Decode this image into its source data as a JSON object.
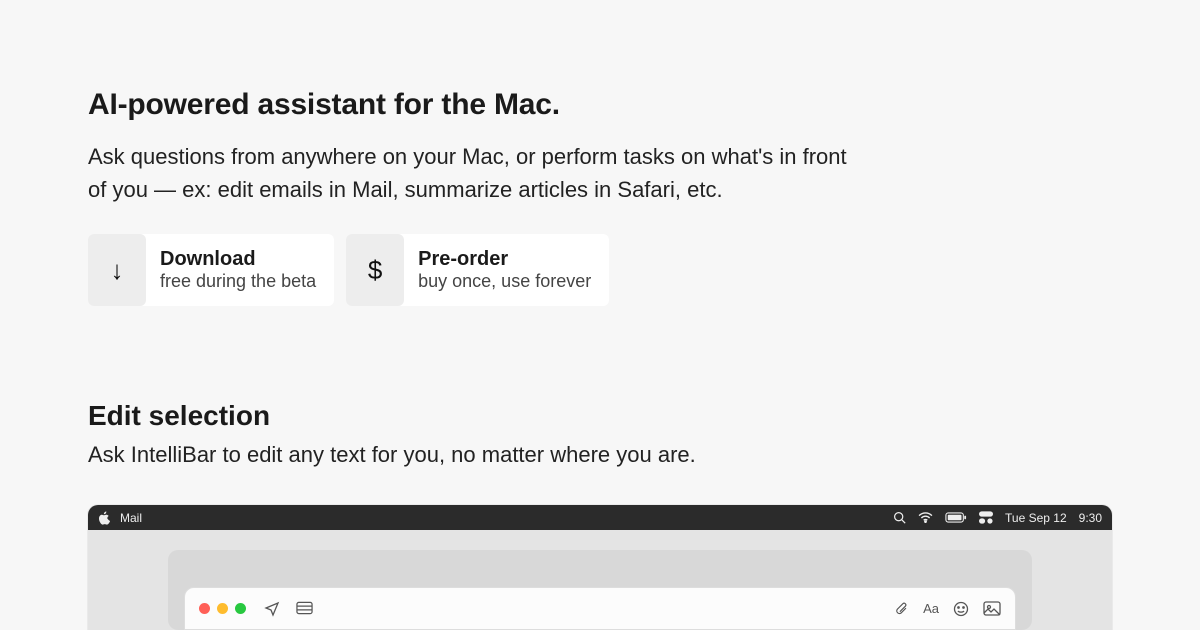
{
  "hero": {
    "headline": "AI-powered assistant for the Mac.",
    "subhead": "Ask questions from anywhere on your Mac, or perform tasks on what's in front of you — ex: edit emails in Mail, summarize articles in Safari, etc."
  },
  "ctas": {
    "download": {
      "icon": "↓",
      "title": "Download",
      "sub": "free during the beta"
    },
    "preorder": {
      "icon": "$",
      "title": "Pre-order",
      "sub": "buy once, use forever"
    }
  },
  "section": {
    "title": "Edit selection",
    "desc": "Ask IntelliBar to edit any text for you, no matter where you are."
  },
  "menubar": {
    "app": "Mail",
    "date": "Tue Sep 12",
    "time": "9:30"
  },
  "mailwin": {
    "format_label": "Aa"
  }
}
